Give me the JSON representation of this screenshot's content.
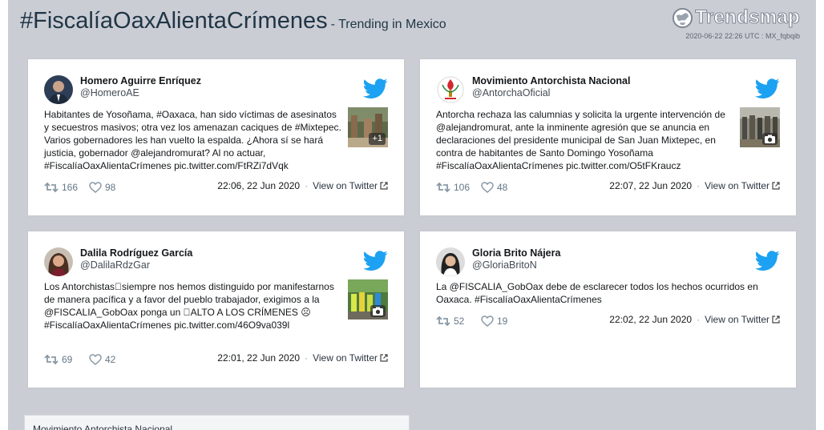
{
  "header": {
    "hashtag": "#FiscalíaOaxAlientaCrímenes",
    "subtitle": "- Trending in Mexico",
    "brand": "Trendsmap",
    "stamp": "2020-06-22 22:26 UTC : MX_fqbqib"
  },
  "tweets": [
    {
      "author": "Homero Aguirre Enríquez",
      "handle": "@HomeroAE",
      "text": "Habitantes de Yosoñama, #Oaxaca, han sido víctimas de asesinatos y secuestros masivos; otra vez los amenazan caciques de #Mixtepec. Varios gobernadores les han vuelto la espalda. ¿Ahora sí se hará justicia, gobernador @alejandromurat? Al no actuar, #FiscalíaOaxAlientaCrímenes pic.twitter.com/FtRZi7dVqk",
      "media_badge": "+1",
      "retweets": "166",
      "likes": "98",
      "time": "22:06, 22 Jun 2020",
      "view_link": "View on Twitter"
    },
    {
      "author": "Movimiento Antorchista Nacional",
      "handle": "@AntorchaOficial",
      "text": "Antorcha rechaza las calumnias y solicita la urgente intervención de @alejandromurat, ante la inminente agresión que se anuncia en declaraciones del presidente municipal de San Juan Mixtepec, en contra de habitantes de Santo Domingo Yosoñama #FiscalíaOaxAlientaCrímenes pic.twitter.com/O5tFKraucz",
      "media_badge": "camera",
      "retweets": "106",
      "likes": "48",
      "time": "22:07, 22 Jun 2020",
      "view_link": "View on Twitter"
    },
    {
      "author": "Dalila Rodríguez García",
      "handle": "@DalilaRdzGar",
      "text": "Los Antorchistas⃞siempre nos hemos distinguido por manifestarnos de manera pacífica y a favor del pueblo trabajador, exigimos a la @FISCALIA_GobOax ponga un ⃞ALTO A LOS CRÍMENES ☹#FiscalíaOaxAlientaCrímenes pic.twitter.com/46O9va039l",
      "media_badge": "camera",
      "retweets": "69",
      "likes": "42",
      "time": "22:01, 22 Jun 2020",
      "view_link": "View on Twitter"
    },
    {
      "author": "Gloria Brito Nájera",
      "handle": "@GloriaBritoN",
      "text": "La @FISCALIA_GobOax debe de esclarecer todos los hechos ocurridos en Oaxaca. #FiscalíaOaxAlientaCrímenes",
      "retweets": "52",
      "likes": "19",
      "time": "22:02, 22 Jun 2020",
      "view_link": "View on Twitter"
    }
  ],
  "bottom_card": {
    "title": "Movimiento Antorchista Nacional"
  },
  "colors": {
    "background": "#cbcdd4",
    "twitter_blue": "#1da1f2",
    "title_text": "#1f3546"
  }
}
